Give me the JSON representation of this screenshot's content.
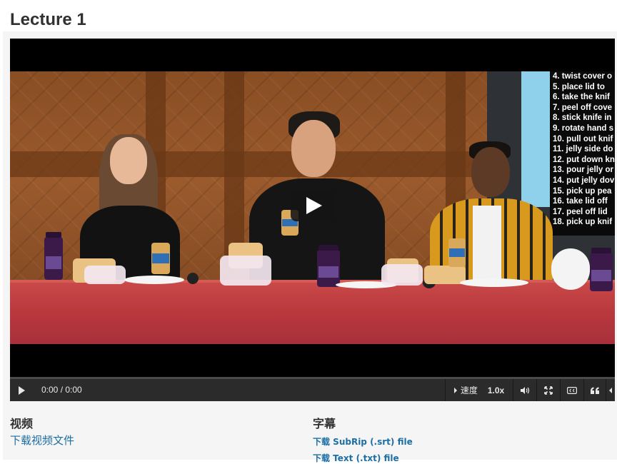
{
  "page": {
    "title": "Lecture 1"
  },
  "video": {
    "steps": [
      "4.  twist cover o",
      "5.  place lid to",
      "6.  take the knif",
      "7.  peel off cove",
      "8.  stick knife in",
      "9.  rotate hand s",
      "10. pull out knif",
      "11. jelly side do",
      "12. put down kn",
      "13. pour jelly or",
      "14. put jelly dov",
      "15. pick up pea",
      "16. take lid off",
      "17. peel off lid",
      "18. pick up knif"
    ],
    "progress_fraction": 0.0
  },
  "controls": {
    "time": "0:00 / 0:00",
    "speed_label": "速度",
    "speed_value": "1.0x",
    "icons": [
      "play-icon",
      "speed-caret-icon",
      "volume-icon",
      "fullscreen-icon",
      "closed-captions-icon",
      "transcript-quote-icon",
      "collapse-caret-icon"
    ]
  },
  "downloads": {
    "video_heading": "视频",
    "video_link": "下载视频文件",
    "subtitles_heading": "字幕",
    "srt_link": "下载 SubRip (.srt) file",
    "txt_link": "下载 Text (.txt) file"
  },
  "colors": {
    "link": "#1c6ea4",
    "control_bar": "#2b2b2b",
    "heading": "#313131"
  }
}
